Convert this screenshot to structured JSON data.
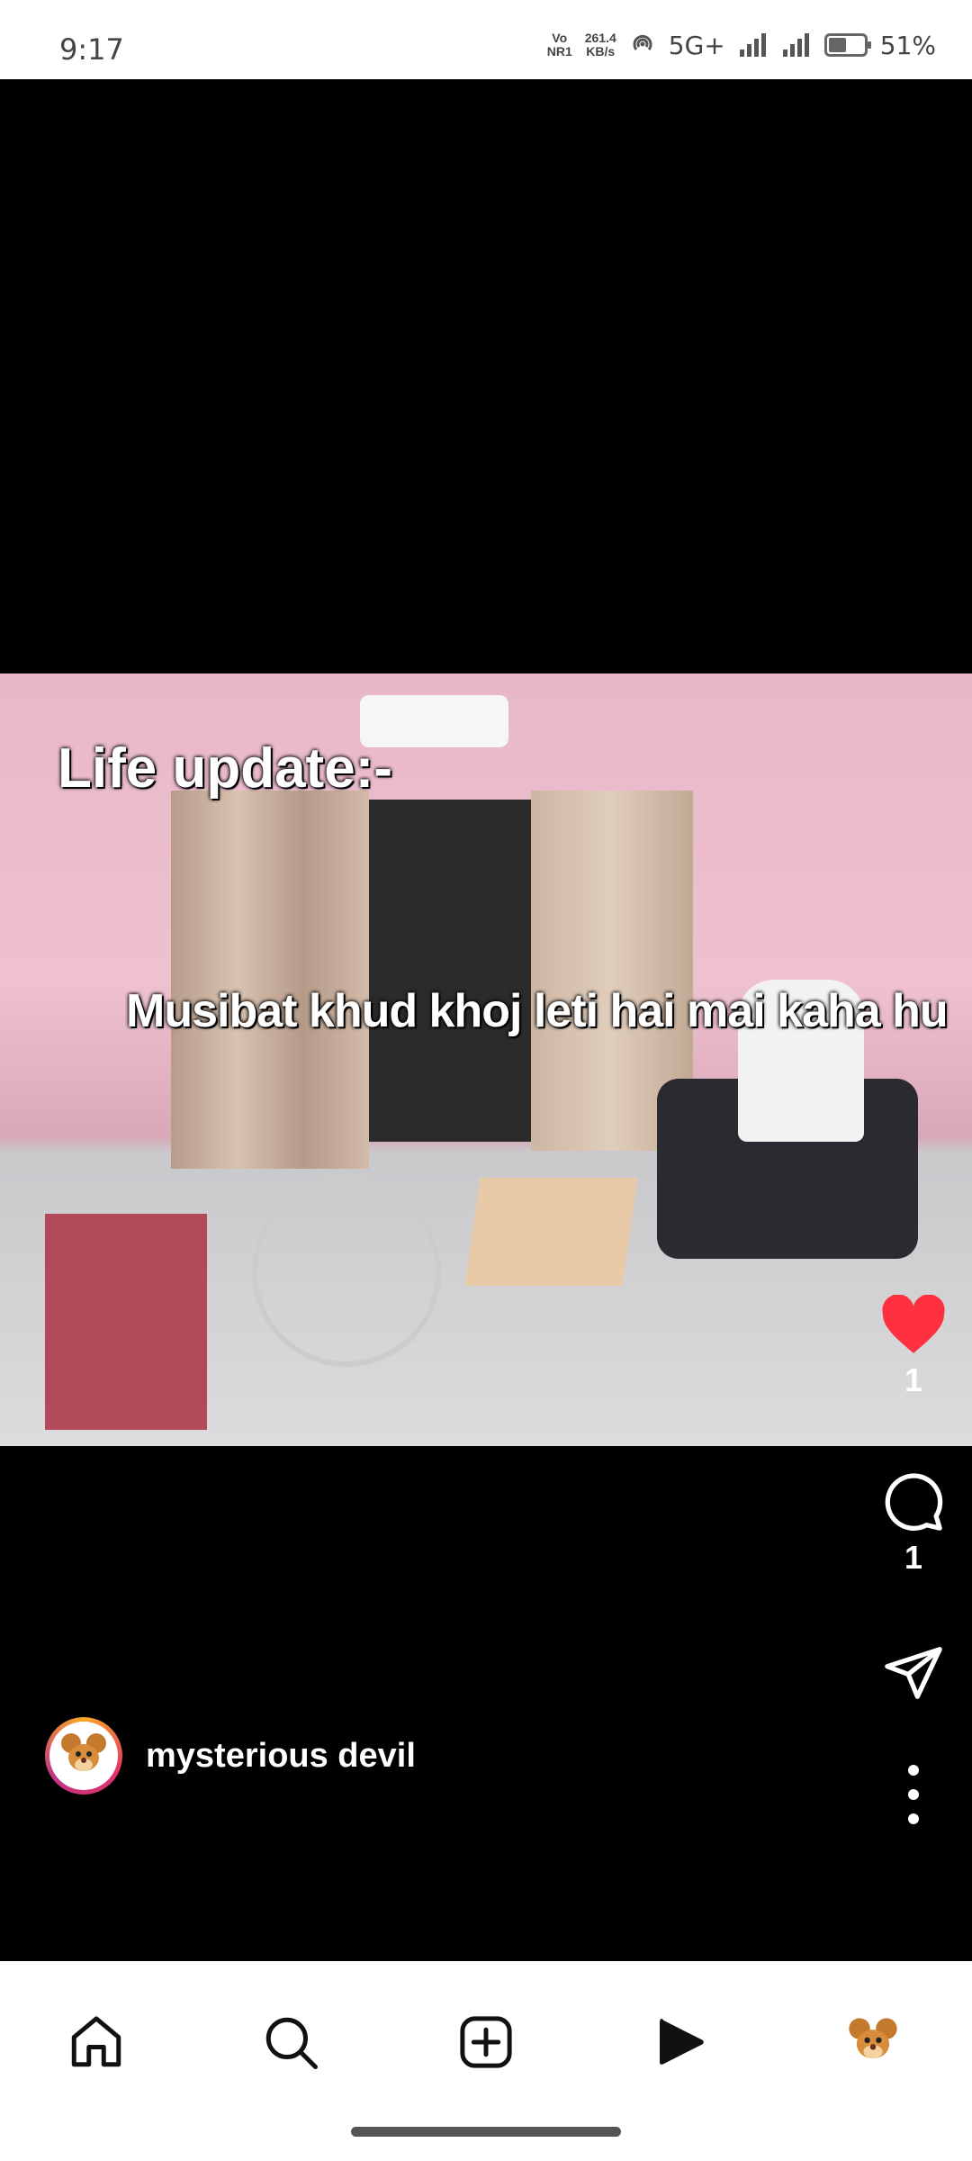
{
  "status_bar": {
    "time": "9:17",
    "volte_top": "Vo",
    "volte_bottom": "NR1",
    "speed_value": "261.4",
    "speed_unit": "KB/s",
    "network": "5G+",
    "battery_percent": "51%",
    "battery_level": 0.51
  },
  "video": {
    "caption_top": "Life update:-",
    "caption_mid": "Musibat khud khoj leti hai mai kaha hu"
  },
  "actions": {
    "like_count": "1",
    "comment_count": "1",
    "like_color": "#ff3040"
  },
  "author": {
    "name": "mysterious devil"
  },
  "nav": {
    "items": [
      "home-icon",
      "search-icon",
      "create-icon",
      "reels-icon",
      "profile-avatar"
    ]
  }
}
